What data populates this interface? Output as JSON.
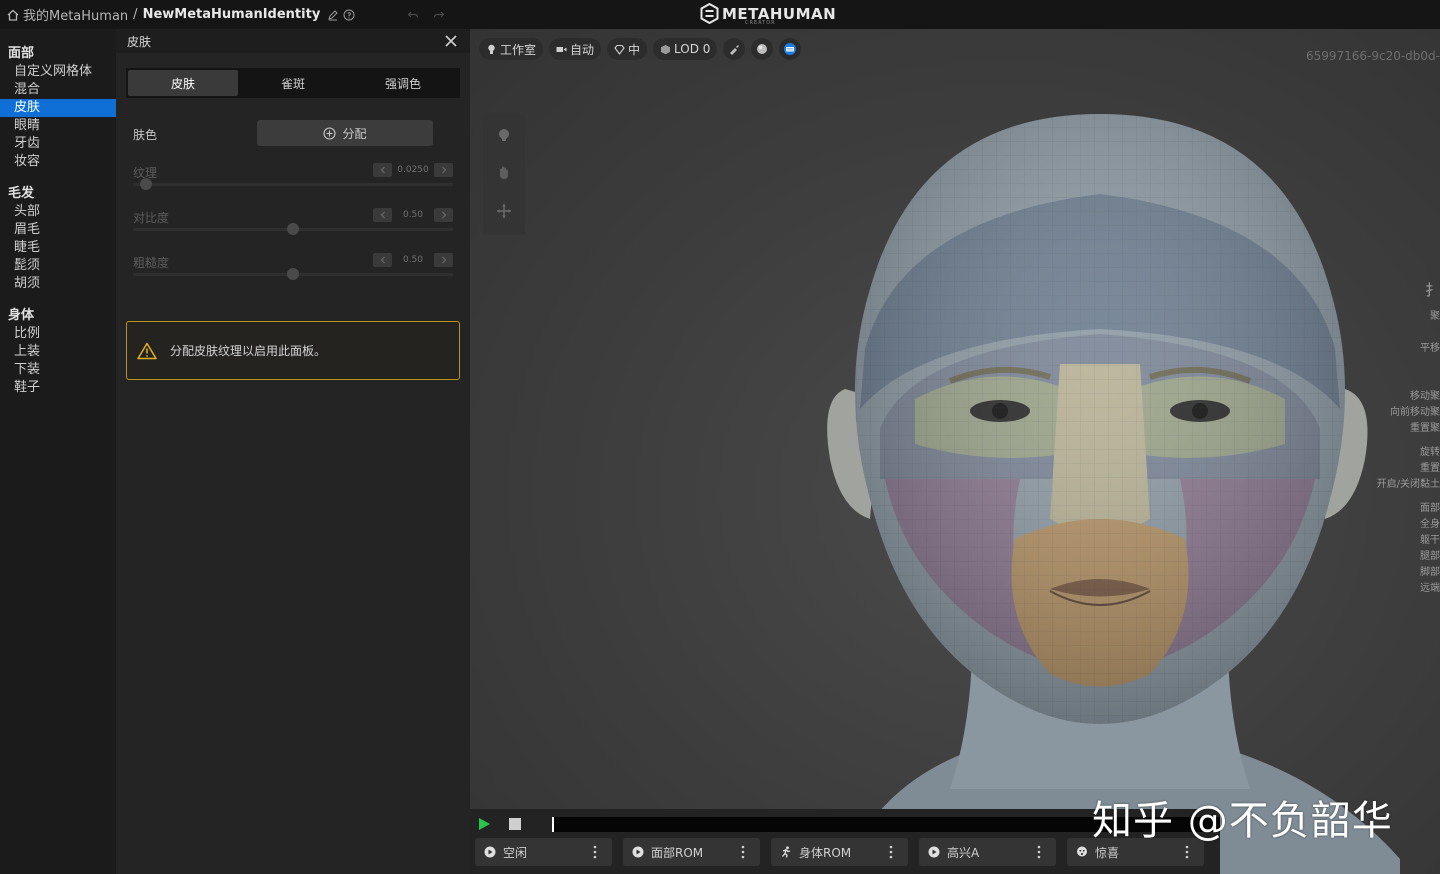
{
  "topbar": {
    "crumb_root": "我的MetaHuman",
    "crumb_sep": "/",
    "crumb_current": "NewMetaHumanIdentity",
    "logo_text": "METAHUMAN",
    "logo_sub": "CREATOR"
  },
  "nav": {
    "groups": [
      {
        "title": "面部",
        "items": [
          "自定义网格体",
          "混合",
          "皮肤",
          "眼睛",
          "牙齿",
          "妆容"
        ]
      },
      {
        "title": "毛发",
        "items": [
          "头部",
          "眉毛",
          "睫毛",
          "髭须",
          "胡须"
        ]
      },
      {
        "title": "身体",
        "items": [
          "比例",
          "上装",
          "下装",
          "鞋子"
        ]
      }
    ],
    "active_item": "皮肤"
  },
  "panel": {
    "title": "皮肤",
    "tabs": [
      "皮肤",
      "雀斑",
      "强调色"
    ],
    "active_tab": "皮肤",
    "skin_color_label": "肤色",
    "assign_label": "分配",
    "sliders": [
      {
        "label": "纹理",
        "value": "0.0250",
        "fraction": 0.04
      },
      {
        "label": "对比度",
        "value": "0.50",
        "fraction": 0.5
      },
      {
        "label": "粗糙度",
        "value": "0.50",
        "fraction": 0.5
      }
    ],
    "warning": "分配皮肤纹理以启用此面板。"
  },
  "viewport": {
    "toolbar": {
      "studio": "工作室",
      "camera": "自动",
      "quality": "中",
      "lod": "LOD 0"
    },
    "uuid": "65997166-9c20-db0d-",
    "right_hints": [
      "扌",
      "聚",
      "平移",
      "移动聚",
      "向前移动聚",
      "重置聚",
      "旋转",
      "重置",
      "开启/关闭黏土",
      "面部",
      "全身",
      "躯干",
      "腿部",
      "脚部",
      "远端"
    ]
  },
  "timeline": {
    "animations": [
      "空闲",
      "面部ROM",
      "身体ROM",
      "高兴A",
      "惊喜"
    ]
  },
  "watermark": "知乎 @不负韶华",
  "colors": {
    "accent": "#0f6fd6",
    "warning_border": "#b8961c",
    "play_green": "#2ec24a"
  }
}
